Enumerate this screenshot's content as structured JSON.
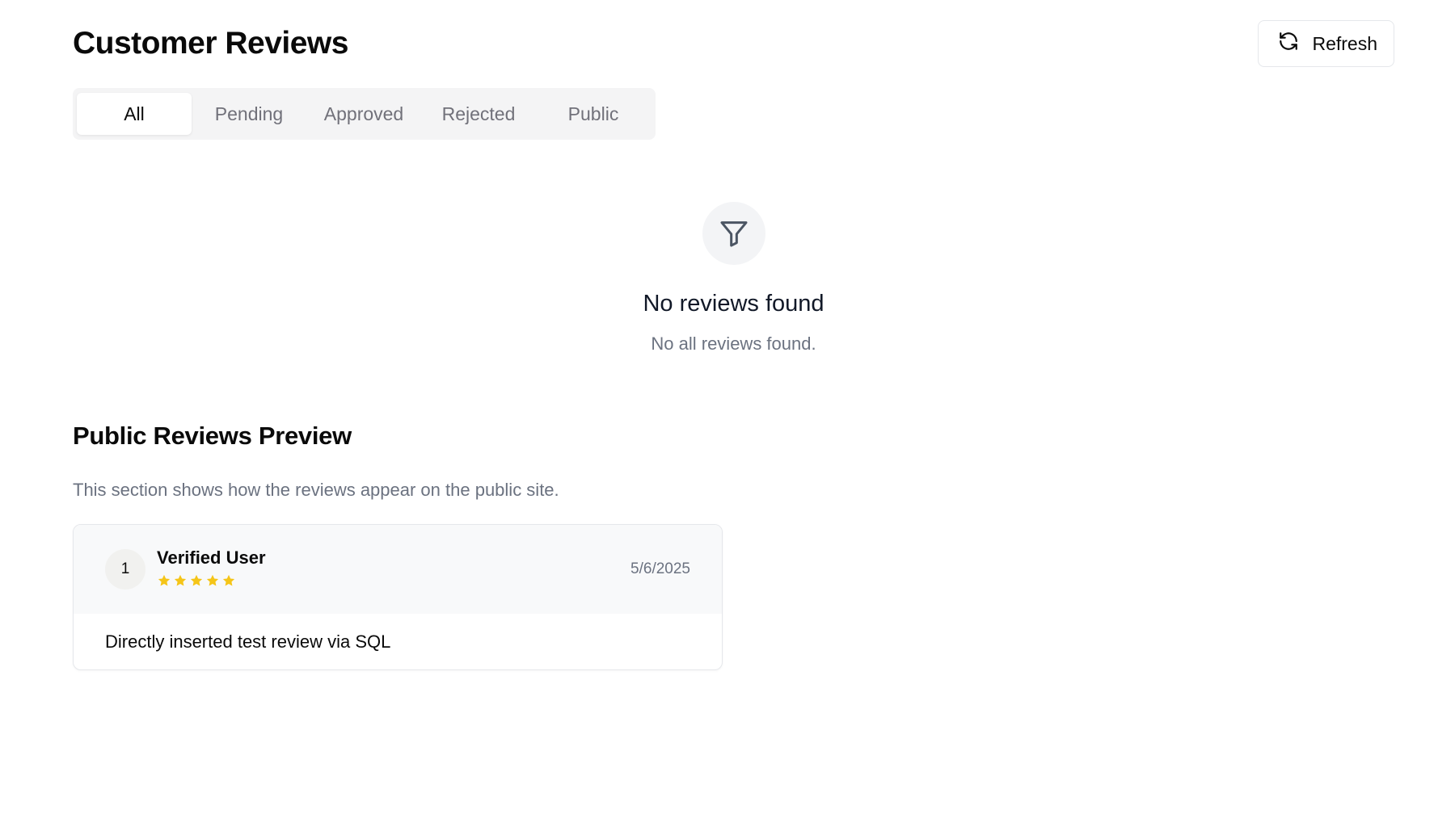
{
  "header": {
    "title": "Customer Reviews",
    "refresh_label": "Refresh"
  },
  "tabs": [
    {
      "label": "All",
      "active": true
    },
    {
      "label": "Pending",
      "active": false
    },
    {
      "label": "Approved",
      "active": false
    },
    {
      "label": "Rejected",
      "active": false
    },
    {
      "label": "Public",
      "active": false
    }
  ],
  "empty_state": {
    "icon": "filter-icon",
    "title": "No reviews found",
    "description": "No all reviews found."
  },
  "public_preview": {
    "title": "Public Reviews Preview",
    "description": "This section shows how the reviews appear on the public site.",
    "reviews": [
      {
        "avatar_text": "1",
        "name": "Verified User",
        "rating": 5,
        "date": "5/6/2025",
        "text": "Directly inserted test review via SQL"
      }
    ]
  },
  "colors": {
    "star": "#f5c518",
    "muted_text": "#6b7280",
    "tab_bg": "#f4f4f5"
  }
}
